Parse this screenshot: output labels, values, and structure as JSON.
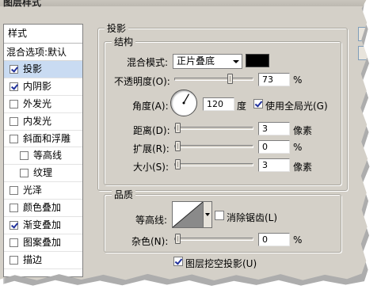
{
  "window": {
    "title": "图层样式"
  },
  "style_list": {
    "header": "样式",
    "blend_options": "混合选项:默认",
    "items": [
      {
        "label": "投影",
        "checked": true,
        "selected": true
      },
      {
        "label": "内阴影",
        "checked": true,
        "selected": false
      },
      {
        "label": "外发光",
        "checked": false,
        "selected": false
      },
      {
        "label": "内发光",
        "checked": false,
        "selected": false
      },
      {
        "label": "斜面和浮雕",
        "checked": false,
        "selected": false
      },
      {
        "label": "等高线",
        "checked": false,
        "selected": false,
        "sub": true
      },
      {
        "label": "纹理",
        "checked": false,
        "selected": false,
        "sub": true
      },
      {
        "label": "光泽",
        "checked": false,
        "selected": false
      },
      {
        "label": "颜色叠加",
        "checked": false,
        "selected": false
      },
      {
        "label": "渐变叠加",
        "checked": true,
        "selected": false
      },
      {
        "label": "图案叠加",
        "checked": false,
        "selected": false
      },
      {
        "label": "描边",
        "checked": false,
        "selected": false
      }
    ]
  },
  "panel": {
    "title": "投影",
    "structure": {
      "title": "结构",
      "blend_mode_label": "混合模式:",
      "blend_mode_value": "正片叠底",
      "shadow_color": "#000000",
      "opacity_label": "不透明度(O):",
      "opacity_value": "73",
      "opacity_unit": "%",
      "opacity_level": 0.73,
      "angle_label": "角度(A):",
      "angle_value": "120",
      "angle_unit": "度",
      "global_light_label": "使用全局光(G)",
      "global_light_checked": true,
      "distance_label": "距离(D):",
      "distance_value": "3",
      "distance_unit": "像素",
      "distance_level": 0.0,
      "spread_label": "扩展(R):",
      "spread_value": "0",
      "spread_unit": "%",
      "spread_level": 0.0,
      "size_label": "大小(S):",
      "size_value": "3",
      "size_unit": "像素",
      "size_level": 0.0
    },
    "quality": {
      "title": "品质",
      "contour_label": "等高线:",
      "anti_alias_label": "消除锯齿(L)",
      "anti_alias_checked": false,
      "noise_label": "杂色(N):",
      "noise_value": "0",
      "noise_unit": "%",
      "noise_level": 0.0
    },
    "knockout_label": "图层挖空投影(U)",
    "knockout_checked": true
  },
  "colors": {
    "dialog_bg": "#d4d0c8",
    "selection": "#c9dbf2",
    "checkmark": "#21319c"
  }
}
